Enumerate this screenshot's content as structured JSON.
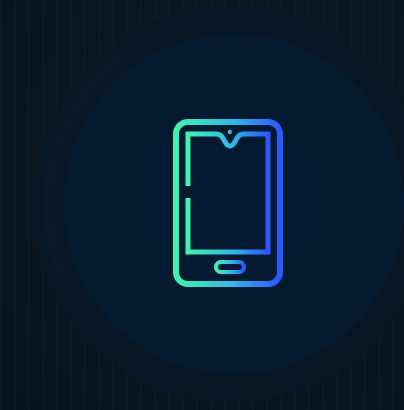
{
  "colors": {
    "background": "#0a1420",
    "circle_outer": "#0b1f33",
    "circle_inner": "#031a30",
    "gradient_start": "#3ff2b0",
    "gradient_end": "#2c57ff"
  },
  "icon": {
    "name": "smartphone-icon"
  }
}
